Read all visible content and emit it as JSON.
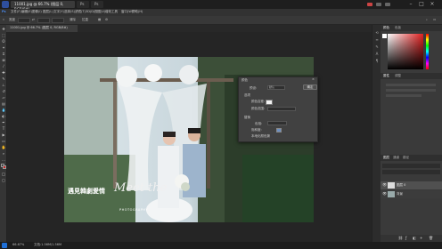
{
  "app": {
    "title_tabs": [
      "11001.jpg @ 66.7% (图层 0, RGB/8#)",
      "Ps",
      "Ps"
    ]
  },
  "menu": [
    "文件(F)",
    "编辑(E)",
    "图像(I)",
    "图层(L)",
    "文字(Y)",
    "选择(S)",
    "滤镜(T)",
    "3D(D)",
    "视图(V)",
    "增效工具",
    "窗口(W)",
    "帮助(H)"
  ],
  "options": {
    "width_label": "宽度",
    "height_label": "高度",
    "res_label": "分辨率",
    "btn_clear": "清除",
    "btn_straighten": "拉直"
  },
  "document": {
    "tab_label": "11001.jpg @ 66.7% (图层 0, RGB/8#)"
  },
  "dialog": {
    "title": "颜色",
    "row1_label": "预设:",
    "row1_value": "默认",
    "ok": "确定",
    "row2_label": "选项",
    "row3_label": "颜色容差:",
    "row4_label": "颜色范围:",
    "section2": "替换",
    "row5_label": "色相:",
    "row6_label": "饱和度:",
    "row7_label": "明度:",
    "check_label": "本地化颜色簇"
  },
  "photo": {
    "chinese_caption": "遇見韓劇愛情",
    "script_text": "Meet the",
    "small_text": "PHOTOGRAPHY"
  },
  "panels": {
    "color_tabs": [
      "颜色",
      "色板"
    ],
    "adjust_tabs": [
      "属性",
      "调整"
    ],
    "layer_tabs": [
      "图层",
      "通道",
      "路径"
    ],
    "layers": [
      "图层 0",
      "背景"
    ]
  },
  "status": {
    "zoom": "66.67%",
    "doc_info": "文档:1.56M/1.56M"
  },
  "colors": {
    "fg": "#ffffff",
    "bg": "#cc2222",
    "picker_hue": "#e02020"
  }
}
